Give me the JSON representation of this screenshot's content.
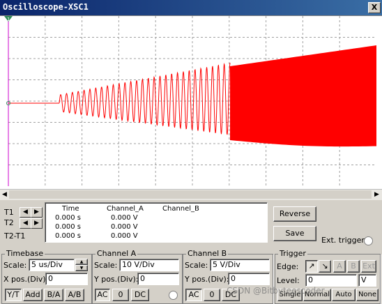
{
  "window": {
    "title": "Oscilloscope-XSC1",
    "close_glyph": "X"
  },
  "cursors": {
    "t1": "T1",
    "t2": "T2",
    "t2_t1": "T2-T1"
  },
  "readout": {
    "headers": [
      "Time",
      "Channel_A",
      "Channel_B"
    ],
    "rows": [
      {
        "time": "0.000 s",
        "a": "0.000 V"
      },
      {
        "time": "0.000 s",
        "a": "0.000 V"
      },
      {
        "time": "0.000 s",
        "a": "0.000 V"
      }
    ]
  },
  "actions": {
    "reverse": "Reverse",
    "save": "Save",
    "ext_trigger": "Ext. trigger"
  },
  "timebase": {
    "title": "Timebase",
    "scale_label": "Scale:",
    "scale_value": "5 us/Div",
    "xpos_label": "X pos.(Div):",
    "xpos_value": "0",
    "modes": [
      "Y/T",
      "Add",
      "B/A",
      "A/B"
    ],
    "active_mode": "Y/T"
  },
  "channel_a": {
    "title": "Channel A",
    "scale_label": "Scale:",
    "scale_value": "10  V/Div",
    "ypos_label": "Y pos.(Div):",
    "ypos_value": "0",
    "coupling": [
      "AC",
      "0",
      "DC"
    ]
  },
  "channel_b": {
    "title": "Channel B",
    "scale_label": "Scale:",
    "scale_value": "5  V/Div",
    "ypos_label": "Y pos.(Div):",
    "ypos_value": "0",
    "coupling": [
      "AC",
      "0",
      "DC"
    ]
  },
  "trigger": {
    "title": "Trigger",
    "edge_label": "Edge:",
    "level_label": "Level:",
    "level_value": "0",
    "level_unit": "V",
    "sources": [
      "A",
      "B",
      "Ext"
    ],
    "modes": [
      "Single",
      "Normal",
      "Auto",
      "None"
    ]
  },
  "watermark": "CSDN @Bitbyteescoder",
  "trace": {
    "color": "#ff0000",
    "grid_color": "#a0a0a0",
    "cursor_color": "#cc00cc"
  }
}
